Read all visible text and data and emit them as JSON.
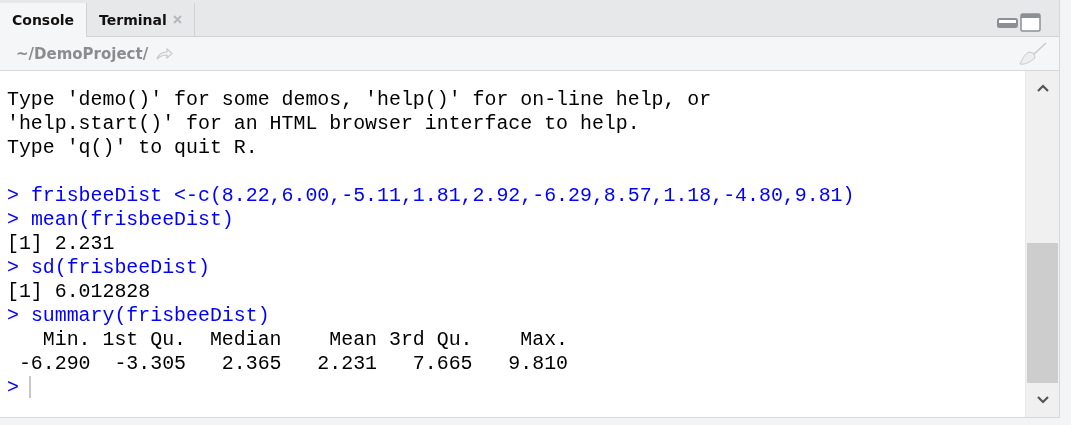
{
  "tabs": [
    {
      "label": "Console",
      "selected": true,
      "closable": false
    },
    {
      "label": "Terminal",
      "selected": false,
      "closable": true
    }
  ],
  "path": "~/DemoProject/",
  "console": {
    "lines": [
      {
        "kind": "output",
        "text": "Type 'demo()' for some demos, 'help()' for on-line help, or"
      },
      {
        "kind": "output",
        "text": "'help.start()' for an HTML browser interface to help."
      },
      {
        "kind": "output",
        "text": "Type 'q()' to quit R."
      },
      {
        "kind": "blank"
      },
      {
        "kind": "input",
        "prompt": ">",
        "text": "frisbeeDist <-c(8.22,6.00,-5.11,1.81,2.92,-6.29,8.57,1.18,-4.80,9.81)"
      },
      {
        "kind": "input",
        "prompt": ">",
        "text": "mean(frisbeeDist)"
      },
      {
        "kind": "output",
        "text": "[1] 2.231"
      },
      {
        "kind": "input",
        "prompt": ">",
        "text": "sd(frisbeeDist)"
      },
      {
        "kind": "output",
        "text": "[1] 6.012828"
      },
      {
        "kind": "input",
        "prompt": ">",
        "text": "summary(frisbeeDist)"
      },
      {
        "kind": "output",
        "text": "   Min. 1st Qu.  Median    Mean 3rd Qu.    Max. "
      },
      {
        "kind": "output",
        "text": " -6.290  -3.305   2.365   2.231   7.665   9.810 "
      },
      {
        "kind": "prompt",
        "prompt": ">"
      }
    ]
  }
}
